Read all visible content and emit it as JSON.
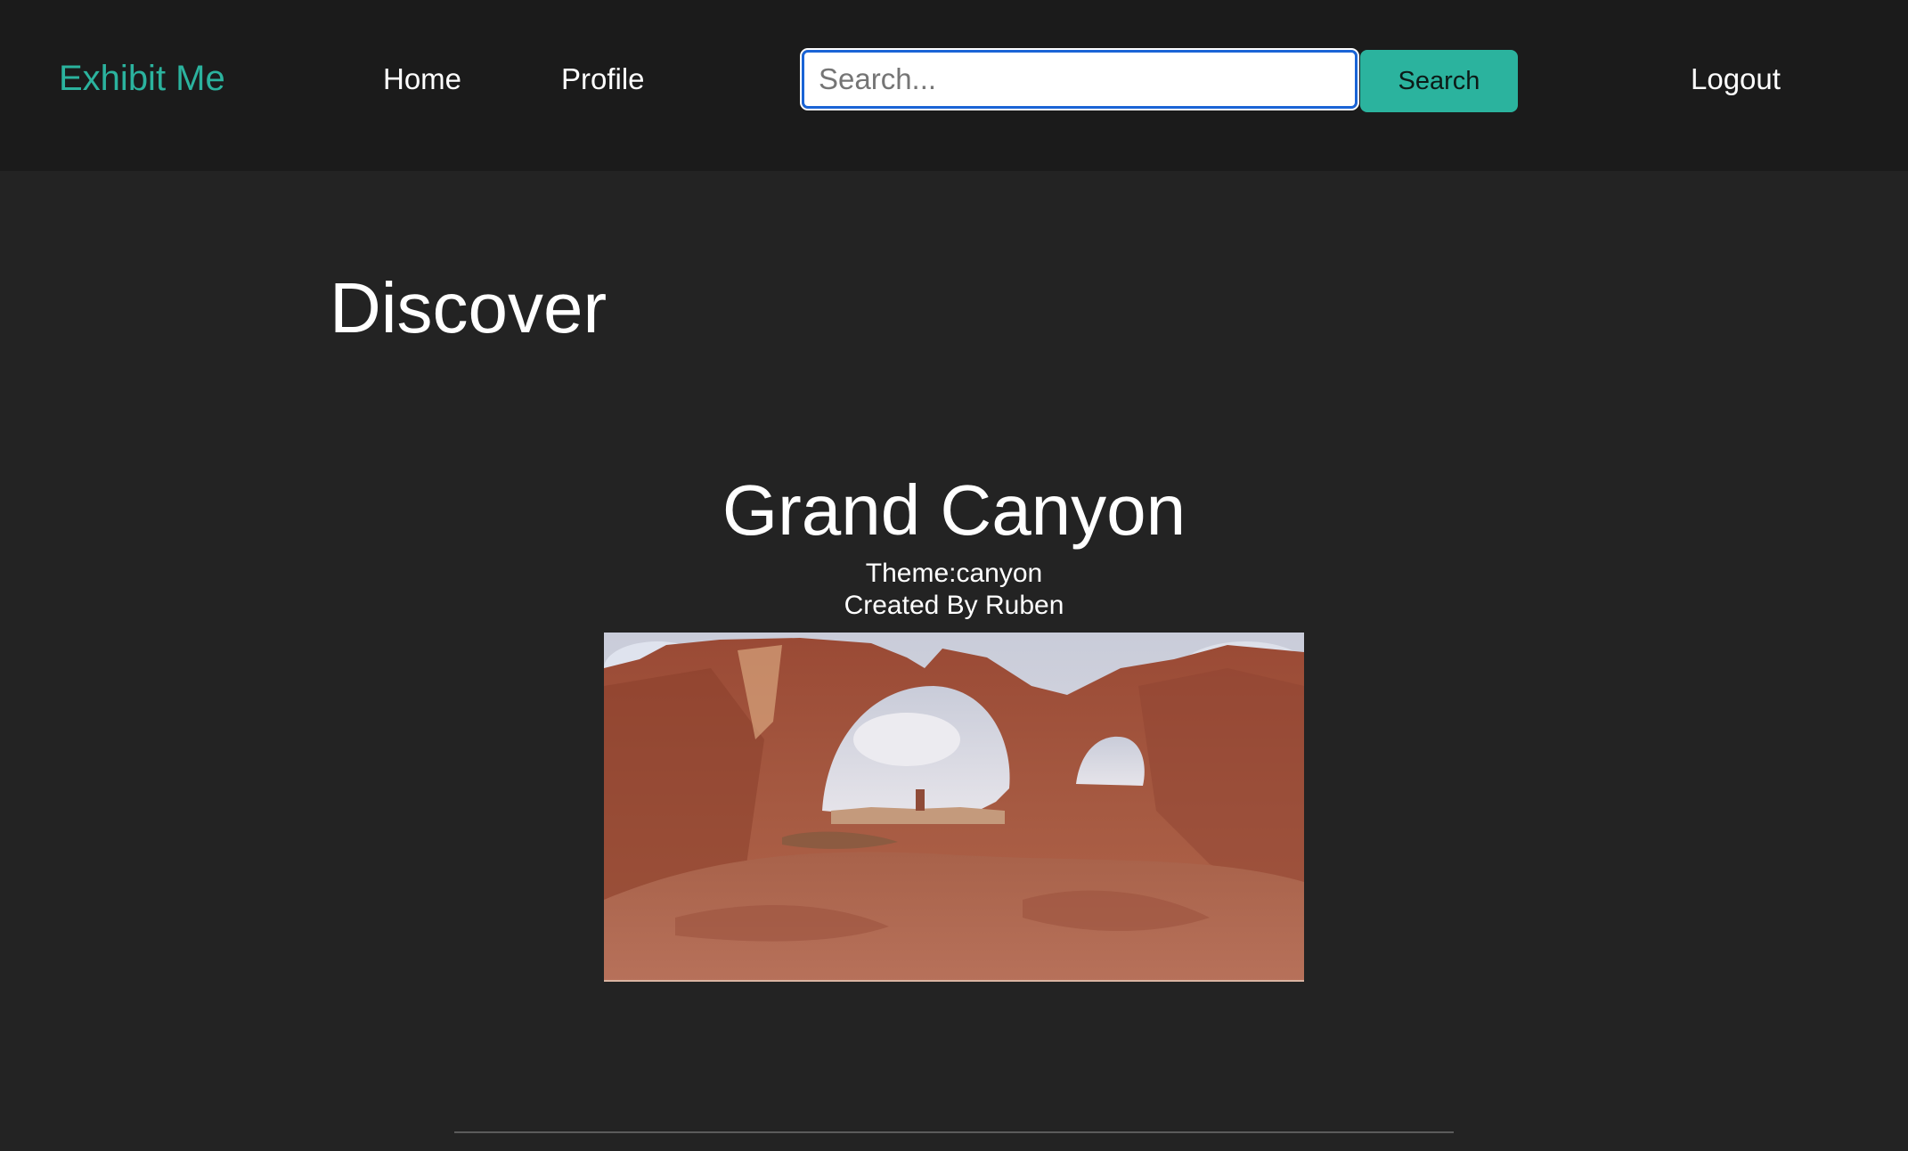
{
  "nav": {
    "brand": "Exhibit Me",
    "home": "Home",
    "profile": "Profile",
    "logout": "Logout",
    "search_placeholder": "Search...",
    "search_value": "",
    "search_button": "Search"
  },
  "main": {
    "title": "Discover",
    "exhibit": {
      "name": "Grand Canyon",
      "theme": "Theme:canyon",
      "creator": "Created By Ruben"
    }
  },
  "colors": {
    "accent": "#2bb39e",
    "navbar_bg": "#1b1b1b",
    "page_bg": "#232323",
    "focus_ring": "#1a64d6"
  }
}
